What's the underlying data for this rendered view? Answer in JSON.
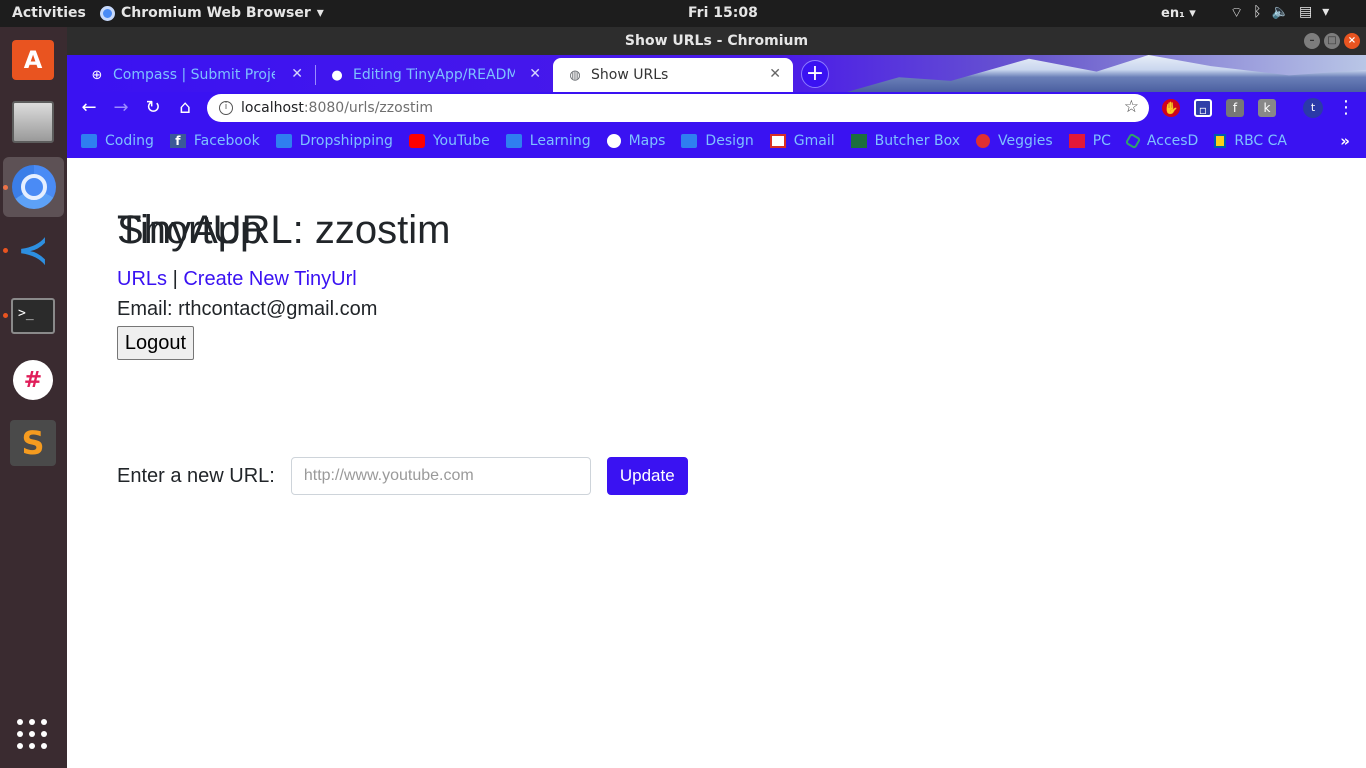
{
  "topbar": {
    "activities": "Activities",
    "app_name": "Chromium Web Browser",
    "clock": "Fri 15:08",
    "lang": "en₁"
  },
  "window": {
    "title": "Show URLs - Chromium"
  },
  "tabs": [
    {
      "title": "Compass | Submit Project",
      "icon": "compass-icon",
      "active": false
    },
    {
      "title": "Editing TinyApp/README",
      "icon": "github-icon",
      "active": false
    },
    {
      "title": "Show URLs",
      "icon": "globe-icon",
      "active": true
    }
  ],
  "omnibox": {
    "host": "localhost",
    "path": ":8080/urls/zzostim"
  },
  "profile_initial": "t",
  "bookmarks": [
    {
      "label": "Coding",
      "icon": "folder-icon"
    },
    {
      "label": "Facebook",
      "icon": "facebook-icon"
    },
    {
      "label": "Dropshipping",
      "icon": "folder-icon"
    },
    {
      "label": "YouTube",
      "icon": "youtube-icon"
    },
    {
      "label": "Learning",
      "icon": "folder-icon"
    },
    {
      "label": "Maps",
      "icon": "globe-icon"
    },
    {
      "label": "Design",
      "icon": "folder-icon"
    },
    {
      "label": "Gmail",
      "icon": "gmail-icon"
    },
    {
      "label": "Butcher Box",
      "icon": "butcherbox-icon"
    },
    {
      "label": "Veggies",
      "icon": "tomato-icon"
    },
    {
      "label": "PC",
      "icon": "pc-icon"
    },
    {
      "label": "AccesD",
      "icon": "accesd-icon"
    },
    {
      "label": "RBC CA",
      "icon": "rbc-icon"
    }
  ],
  "page": {
    "app_title": "TinyApp",
    "nav": {
      "urls": "URLs",
      "separator": "|",
      "create": "Create New TinyUrl"
    },
    "email_label": "Email:",
    "email": "rthcontact@gmail.com",
    "logout": "Logout",
    "short_heading": "ShortURL: zzostim",
    "form": {
      "label": "Enter a new URL:",
      "placeholder": "http://www.youtube.com",
      "submit": "Update"
    }
  },
  "colors": {
    "accent": "#3a12f2",
    "ubuntu_orange": "#e95420"
  }
}
